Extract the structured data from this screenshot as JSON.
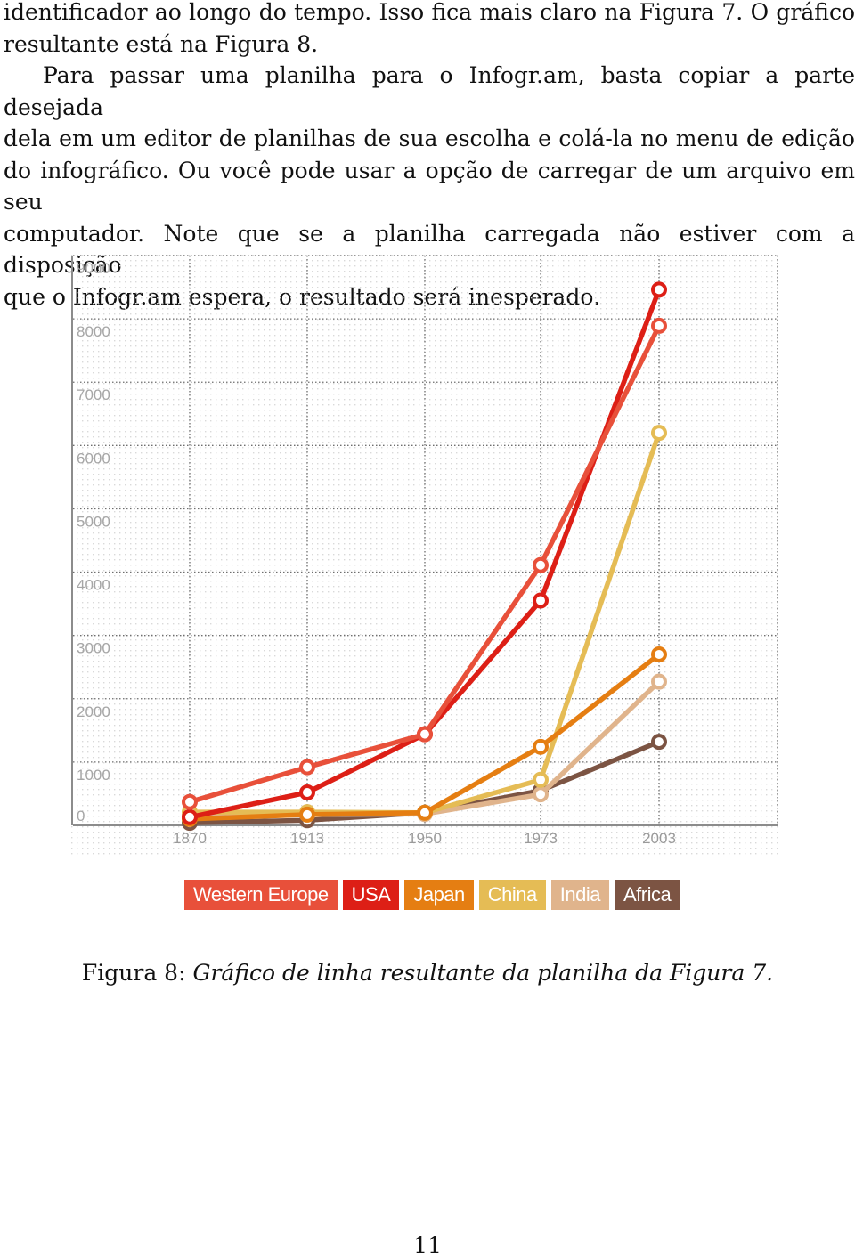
{
  "body_text": {
    "paragraph1_lines": [
      "identificador ao longo do tempo. Isso fica mais claro na Figura 7. O gráfico",
      "resultante está na Figura 8."
    ],
    "paragraph2_lines": [
      "Para passar uma planilha para o Infogr.am, basta copiar a parte desejada",
      "dela em um editor de planilhas de sua escolha e colá-la no menu de edição",
      "do infográfico. Ou você pode usar a opção de carregar de um arquivo em seu",
      "computador. Note que se a planilha carregada não estiver com a disposição",
      "que o Infogr.am espera, o resultado será inesperado."
    ]
  },
  "figure": {
    "caption_label": "Figura 8:",
    "caption_text": "Gráfico de linha resultante da planilha da Figura 7."
  },
  "page_number": "11",
  "chart_data": {
    "type": "line",
    "title": "",
    "xlabel": "",
    "ylabel": "",
    "x": [
      "1870",
      "1913",
      "1950",
      "1973",
      "2003"
    ],
    "ylim": [
      0,
      9000
    ],
    "yticks": [
      "0",
      "1000",
      "2000",
      "3000",
      "4000",
      "5000",
      "6000",
      "7000",
      "8000",
      "9000"
    ],
    "grid": true,
    "legend_position": "bottom",
    "series": [
      {
        "name": "Western Europe",
        "color": "#e8503a",
        "values": [
          370,
          920,
          1440,
          4110,
          7890
        ]
      },
      {
        "name": "USA",
        "color": "#dd1f16",
        "values": [
          130,
          520,
          1440,
          3550,
          8460
        ]
      },
      {
        "name": "Japan",
        "color": "#e57e12",
        "values": [
          100,
          170,
          200,
          1240,
          2700
        ]
      },
      {
        "name": "China",
        "color": "#e5bc55",
        "values": [
          210,
          210,
          200,
          720,
          6200
        ]
      },
      {
        "name": "India",
        "color": "#e0b48c",
        "values": [
          170,
          170,
          180,
          490,
          2270
        ]
      },
      {
        "name": "Africa",
        "color": "#7c5443",
        "values": [
          40,
          80,
          200,
          550,
          1320
        ]
      }
    ]
  }
}
